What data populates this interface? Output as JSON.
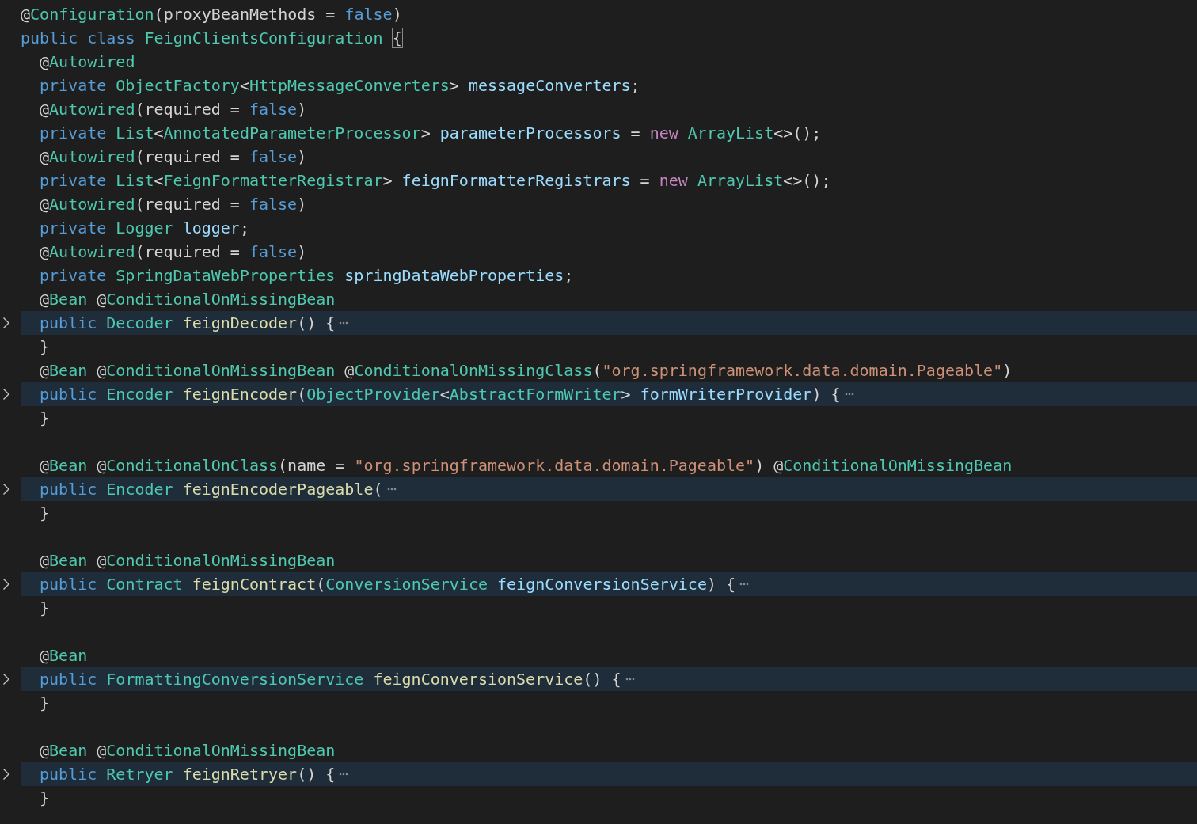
{
  "editor": {
    "lines": [
      {
        "kind": "code",
        "folded": false,
        "tokens": [
          {
            "text": "@",
            "kind": "plain"
          },
          {
            "text": "Configuration",
            "kind": "type"
          },
          {
            "text": "(proxyBeanMethods = ",
            "kind": "plain"
          },
          {
            "text": "false",
            "kind": "kw"
          },
          {
            "text": ")",
            "kind": "plain"
          }
        ]
      },
      {
        "kind": "code",
        "folded": false,
        "tokens": [
          {
            "text": "public class ",
            "kind": "kw"
          },
          {
            "text": "FeignClientsConfiguration ",
            "kind": "type"
          },
          {
            "text": "{",
            "kind": "match"
          }
        ],
        "children": [
          {
            "kind": "code",
            "folded": false,
            "tokens": [
              {
                "text": "@",
                "kind": "plain"
              },
              {
                "text": "Autowired",
                "kind": "type"
              }
            ]
          },
          {
            "kind": "code",
            "folded": false,
            "tokens": [
              {
                "text": "private ",
                "kind": "kw"
              },
              {
                "text": "ObjectFactory",
                "kind": "type"
              },
              {
                "text": "<",
                "kind": "plain"
              },
              {
                "text": "HttpMessageConverters",
                "kind": "type"
              },
              {
                "text": "> ",
                "kind": "plain"
              },
              {
                "text": "messageConverters",
                "kind": "var"
              },
              {
                "text": ";",
                "kind": "plain"
              }
            ]
          },
          {
            "kind": "code",
            "folded": false,
            "tokens": [
              {
                "text": "@",
                "kind": "plain"
              },
              {
                "text": "Autowired",
                "kind": "type"
              },
              {
                "text": "(required = ",
                "kind": "plain"
              },
              {
                "text": "false",
                "kind": "kw"
              },
              {
                "text": ")",
                "kind": "plain"
              }
            ]
          },
          {
            "kind": "code",
            "folded": false,
            "tokens": [
              {
                "text": "private ",
                "kind": "kw"
              },
              {
                "text": "List",
                "kind": "type"
              },
              {
                "text": "<",
                "kind": "plain"
              },
              {
                "text": "AnnotatedParameterProcessor",
                "kind": "type"
              },
              {
                "text": "> ",
                "kind": "plain"
              },
              {
                "text": "parameterProcessors",
                "kind": "var"
              },
              {
                "text": " = ",
                "kind": "plain"
              },
              {
                "text": "new ",
                "kind": "new"
              },
              {
                "text": "ArrayList",
                "kind": "type"
              },
              {
                "text": "<>();",
                "kind": "plain"
              }
            ]
          },
          {
            "kind": "code",
            "folded": false,
            "tokens": [
              {
                "text": "@",
                "kind": "plain"
              },
              {
                "text": "Autowired",
                "kind": "type"
              },
              {
                "text": "(required = ",
                "kind": "plain"
              },
              {
                "text": "false",
                "kind": "kw"
              },
              {
                "text": ")",
                "kind": "plain"
              }
            ]
          },
          {
            "kind": "code",
            "folded": false,
            "tokens": [
              {
                "text": "private ",
                "kind": "kw"
              },
              {
                "text": "List",
                "kind": "type"
              },
              {
                "text": "<",
                "kind": "plain"
              },
              {
                "text": "FeignFormatterRegistrar",
                "kind": "type"
              },
              {
                "text": "> ",
                "kind": "plain"
              },
              {
                "text": "feignFormatterRegistrars",
                "kind": "var"
              },
              {
                "text": " = ",
                "kind": "plain"
              },
              {
                "text": "new ",
                "kind": "new"
              },
              {
                "text": "ArrayList",
                "kind": "type"
              },
              {
                "text": "<>();",
                "kind": "plain"
              }
            ]
          },
          {
            "kind": "code",
            "folded": false,
            "tokens": [
              {
                "text": "@",
                "kind": "plain"
              },
              {
                "text": "Autowired",
                "kind": "type"
              },
              {
                "text": "(required = ",
                "kind": "plain"
              },
              {
                "text": "false",
                "kind": "kw"
              },
              {
                "text": ")",
                "kind": "plain"
              }
            ]
          },
          {
            "kind": "code",
            "folded": false,
            "tokens": [
              {
                "text": "private ",
                "kind": "kw"
              },
              {
                "text": "Logger ",
                "kind": "type"
              },
              {
                "text": "logger",
                "kind": "var"
              },
              {
                "text": ";",
                "kind": "plain"
              }
            ]
          },
          {
            "kind": "code",
            "folded": false,
            "tokens": [
              {
                "text": "@",
                "kind": "plain"
              },
              {
                "text": "Autowired",
                "kind": "type"
              },
              {
                "text": "(required = ",
                "kind": "plain"
              },
              {
                "text": "false",
                "kind": "kw"
              },
              {
                "text": ")",
                "kind": "plain"
              }
            ]
          },
          {
            "kind": "code",
            "folded": false,
            "tokens": [
              {
                "text": "private ",
                "kind": "kw"
              },
              {
                "text": "SpringDataWebProperties ",
                "kind": "type"
              },
              {
                "text": "springDataWebProperties",
                "kind": "var"
              },
              {
                "text": ";",
                "kind": "plain"
              }
            ]
          },
          {
            "kind": "code",
            "folded": false,
            "tokens": [
              {
                "text": "@",
                "kind": "plain"
              },
              {
                "text": "Bean",
                "kind": "type"
              },
              {
                "text": " @",
                "kind": "plain"
              },
              {
                "text": "ConditionalOnMissingBean",
                "kind": "type"
              }
            ]
          },
          {
            "kind": "code",
            "folded": true,
            "tokens": [
              {
                "text": "public ",
                "kind": "kw"
              },
              {
                "text": "Decoder ",
                "kind": "type"
              },
              {
                "text": "feignDecoder",
                "kind": "fn"
              },
              {
                "text": "() {",
                "kind": "plain"
              }
            ]
          },
          {
            "kind": "code",
            "folded": false,
            "tokens": [
              {
                "text": "}",
                "kind": "plain"
              }
            ]
          },
          {
            "kind": "code",
            "folded": false,
            "tokens": [
              {
                "text": "@",
                "kind": "plain"
              },
              {
                "text": "Bean",
                "kind": "type"
              },
              {
                "text": " @",
                "kind": "plain"
              },
              {
                "text": "ConditionalOnMissingBean",
                "kind": "type"
              },
              {
                "text": " @",
                "kind": "plain"
              },
              {
                "text": "ConditionalOnMissingClass",
                "kind": "type"
              },
              {
                "text": "(",
                "kind": "plain"
              },
              {
                "text": "\"org.springframework.data.domain.Pageable\"",
                "kind": "str"
              },
              {
                "text": ")",
                "kind": "plain"
              }
            ]
          },
          {
            "kind": "code",
            "folded": true,
            "tokens": [
              {
                "text": "public ",
                "kind": "kw"
              },
              {
                "text": "Encoder ",
                "kind": "type"
              },
              {
                "text": "feignEncoder",
                "kind": "fn"
              },
              {
                "text": "(",
                "kind": "plain"
              },
              {
                "text": "ObjectProvider",
                "kind": "type"
              },
              {
                "text": "<",
                "kind": "plain"
              },
              {
                "text": "AbstractFormWriter",
                "kind": "type"
              },
              {
                "text": "> ",
                "kind": "plain"
              },
              {
                "text": "formWriterProvider",
                "kind": "var"
              },
              {
                "text": ") {",
                "kind": "plain"
              }
            ]
          },
          {
            "kind": "code",
            "folded": false,
            "tokens": [
              {
                "text": "}",
                "kind": "plain"
              }
            ]
          },
          {
            "kind": "blank"
          },
          {
            "kind": "code",
            "folded": false,
            "tokens": [
              {
                "text": "@",
                "kind": "plain"
              },
              {
                "text": "Bean",
                "kind": "type"
              },
              {
                "text": " @",
                "kind": "plain"
              },
              {
                "text": "ConditionalOnClass",
                "kind": "type"
              },
              {
                "text": "(name = ",
                "kind": "plain"
              },
              {
                "text": "\"org.springframework.data.domain.Pageable\"",
                "kind": "str"
              },
              {
                "text": ") @",
                "kind": "plain"
              },
              {
                "text": "ConditionalOnMissingBean",
                "kind": "type"
              }
            ]
          },
          {
            "kind": "code",
            "folded": true,
            "tokens": [
              {
                "text": "public ",
                "kind": "kw"
              },
              {
                "text": "Encoder ",
                "kind": "type"
              },
              {
                "text": "feignEncoderPageable",
                "kind": "fn"
              },
              {
                "text": "(",
                "kind": "plain"
              }
            ]
          },
          {
            "kind": "code",
            "folded": false,
            "tokens": [
              {
                "text": "}",
                "kind": "plain"
              }
            ]
          },
          {
            "kind": "blank"
          },
          {
            "kind": "code",
            "folded": false,
            "tokens": [
              {
                "text": "@",
                "kind": "plain"
              },
              {
                "text": "Bean",
                "kind": "type"
              },
              {
                "text": " @",
                "kind": "plain"
              },
              {
                "text": "ConditionalOnMissingBean",
                "kind": "type"
              }
            ]
          },
          {
            "kind": "code",
            "folded": true,
            "tokens": [
              {
                "text": "public ",
                "kind": "kw"
              },
              {
                "text": "Contract ",
                "kind": "type"
              },
              {
                "text": "feignContract",
                "kind": "fn"
              },
              {
                "text": "(",
                "kind": "plain"
              },
              {
                "text": "ConversionService ",
                "kind": "type"
              },
              {
                "text": "feignConversionService",
                "kind": "var"
              },
              {
                "text": ") {",
                "kind": "plain"
              }
            ]
          },
          {
            "kind": "code",
            "folded": false,
            "tokens": [
              {
                "text": "}",
                "kind": "plain"
              }
            ]
          },
          {
            "kind": "blank"
          },
          {
            "kind": "code",
            "folded": false,
            "tokens": [
              {
                "text": "@",
                "kind": "plain"
              },
              {
                "text": "Bean",
                "kind": "type"
              }
            ]
          },
          {
            "kind": "code",
            "folded": true,
            "tokens": [
              {
                "text": "public ",
                "kind": "kw"
              },
              {
                "text": "FormattingConversionService ",
                "kind": "type"
              },
              {
                "text": "feignConversionService",
                "kind": "fn"
              },
              {
                "text": "() {",
                "kind": "plain"
              }
            ]
          },
          {
            "kind": "code",
            "folded": false,
            "tokens": [
              {
                "text": "}",
                "kind": "plain"
              }
            ]
          },
          {
            "kind": "blank"
          },
          {
            "kind": "code",
            "folded": false,
            "tokens": [
              {
                "text": "@",
                "kind": "plain"
              },
              {
                "text": "Bean",
                "kind": "type"
              },
              {
                "text": " @",
                "kind": "plain"
              },
              {
                "text": "ConditionalOnMissingBean",
                "kind": "type"
              }
            ]
          },
          {
            "kind": "code",
            "folded": true,
            "tokens": [
              {
                "text": "public ",
                "kind": "kw"
              },
              {
                "text": "Retryer ",
                "kind": "type"
              },
              {
                "text": "feignRetryer",
                "kind": "fn"
              },
              {
                "text": "() {",
                "kind": "plain"
              }
            ]
          },
          {
            "kind": "code",
            "folded": false,
            "tokens": [
              {
                "text": "}",
                "kind": "plain"
              }
            ]
          }
        ]
      }
    ]
  }
}
